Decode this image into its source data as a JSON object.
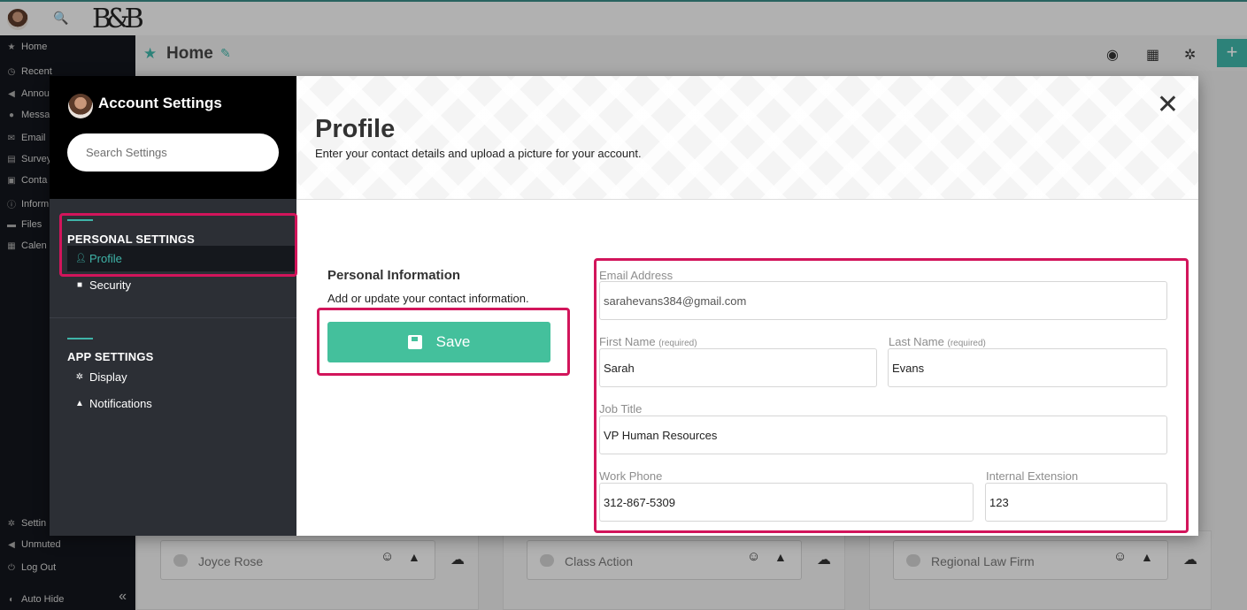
{
  "app": {
    "logo_text": "B&B",
    "home_title": "Home"
  },
  "left_nav": {
    "items": [
      {
        "label": "Home",
        "icon": "star-icon"
      },
      {
        "label": "Recent",
        "icon": "clock-icon"
      },
      {
        "label": "Annou",
        "icon": "megaphone-icon"
      },
      {
        "label": "Messa",
        "icon": "chat-icon"
      },
      {
        "label": "Email",
        "icon": "envelope-icon"
      },
      {
        "label": "Survey",
        "icon": "clipboard-icon"
      },
      {
        "label": "Conta",
        "icon": "contact-icon"
      },
      {
        "label": "Inform",
        "icon": "info-icon"
      },
      {
        "label": "Files",
        "icon": "folder-icon"
      },
      {
        "label": "Calen",
        "icon": "calendar-icon"
      },
      {
        "label": "Settin",
        "icon": "gear-icon"
      },
      {
        "label": "Unmuted",
        "icon": "speaker-icon"
      },
      {
        "label": "Log Out",
        "icon": "logout-icon"
      },
      {
        "label": "Auto Hide",
        "icon": "toggle-icon"
      }
    ]
  },
  "cards": [
    {
      "placeholder": "Joyce Rose"
    },
    {
      "placeholder": "Class Action"
    },
    {
      "placeholder": "Regional Law Firm"
    }
  ],
  "modal": {
    "title": "Account Settings",
    "search_placeholder": "Search Settings",
    "sections": [
      {
        "title": "PERSONAL SETTINGS",
        "items": [
          {
            "label": "Profile",
            "icon": "user-icon",
            "active": true
          },
          {
            "label": "Security",
            "icon": "lock-icon",
            "active": false
          }
        ]
      },
      {
        "title": "APP SETTINGS",
        "items": [
          {
            "label": "Display",
            "icon": "gear-icon",
            "active": false
          },
          {
            "label": "Notifications",
            "icon": "bell-icon",
            "active": false
          }
        ]
      }
    ],
    "close_icon": "close-icon"
  },
  "profile": {
    "title": "Profile",
    "subtitle": "Enter your contact details and upload a picture for your account.",
    "section_title": "Personal Information",
    "section_desc": "Add or update your contact information.",
    "save_label": "Save",
    "required_note": "(required)",
    "fields": {
      "email": {
        "label": "Email Address",
        "value": "sarahevans384@gmail.com"
      },
      "first_name": {
        "label": "First Name",
        "value": "Sarah"
      },
      "last_name": {
        "label": "Last Name",
        "value": "Evans"
      },
      "job_title": {
        "label": "Job Title",
        "value": "VP Human Resources"
      },
      "work_phone": {
        "label": "Work Phone",
        "value": "312-867-5309"
      },
      "internal_extension": {
        "label": "Internal Extension",
        "value": "123"
      }
    }
  },
  "colors": {
    "accent": "#3fb4a8",
    "save_green": "#44c09c",
    "highlight": "#d2155b"
  }
}
